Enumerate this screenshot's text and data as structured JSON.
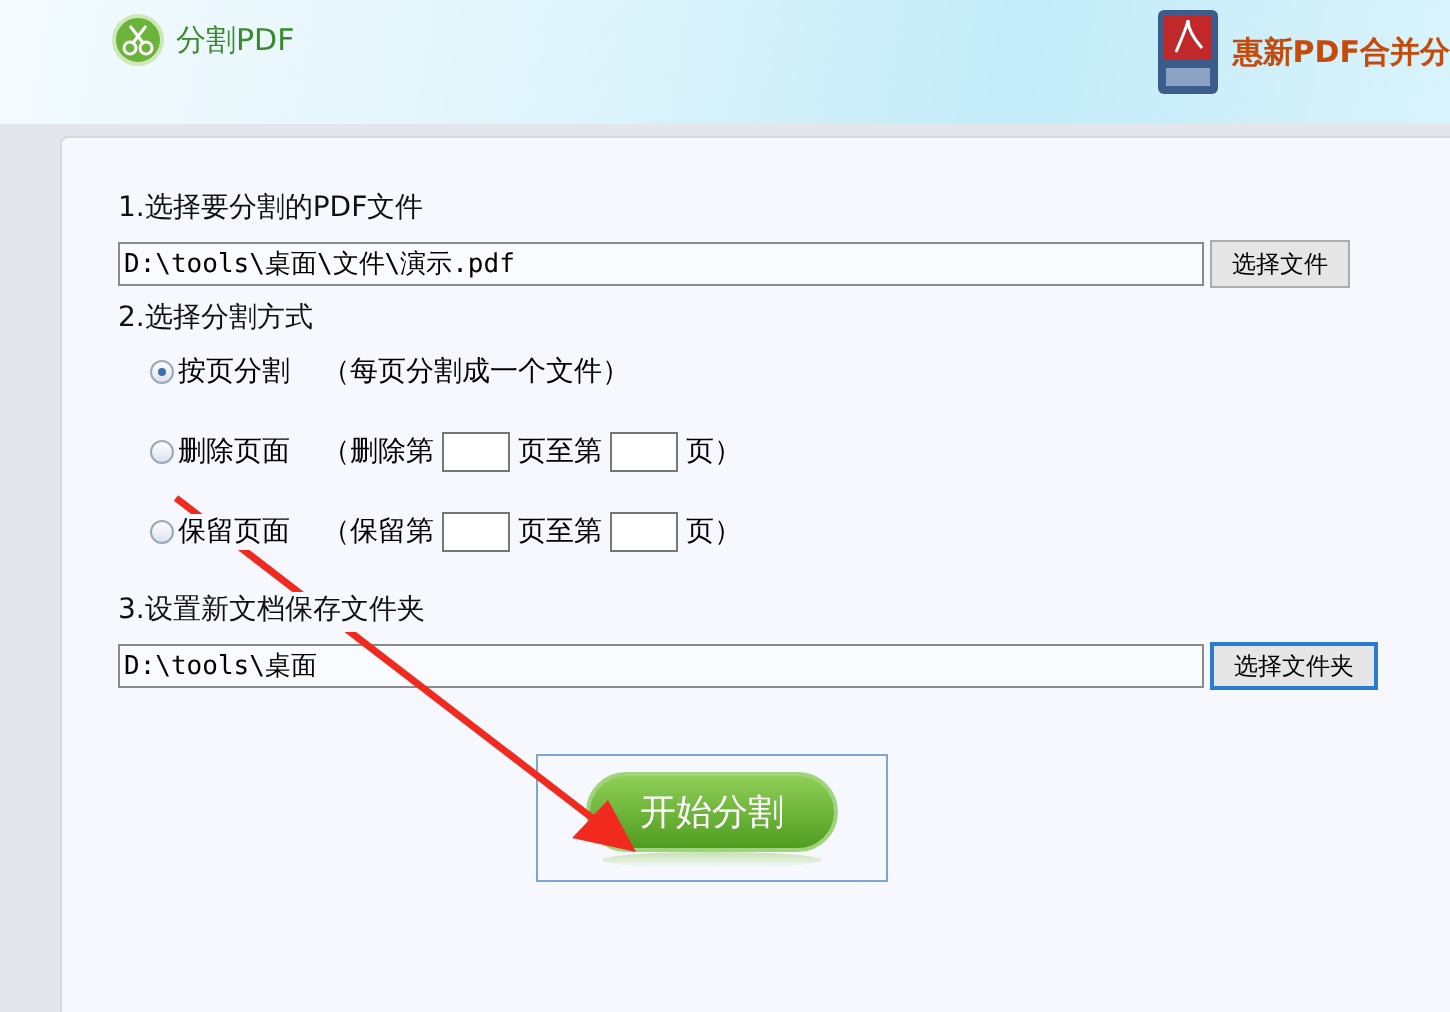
{
  "header": {
    "app_title": "分割PDF",
    "product_name": "惠新PDF合并分"
  },
  "step1": {
    "label": "1.选择要分割的PDF文件",
    "path": "D:\\tools\\桌面\\文件\\演示.pdf",
    "button": "选择文件"
  },
  "step2": {
    "label": "2.选择分割方式",
    "options": [
      {
        "kind": "plain",
        "label": "按页分割",
        "note": "（每页分割成一个文件）",
        "selected": true
      },
      {
        "kind": "range",
        "label": "删除页面",
        "prefix": "（删除第",
        "middle": "页至第",
        "suffix": "页）",
        "selected": false
      },
      {
        "kind": "range",
        "label": "保留页面",
        "prefix": "（保留第",
        "middle": "页至第",
        "suffix": "页）",
        "selected": false
      }
    ]
  },
  "step3": {
    "label": "3.设置新文档保存文件夹",
    "path": "D:\\tools\\桌面",
    "button": "选择文件夹"
  },
  "start_button": "开始分割"
}
